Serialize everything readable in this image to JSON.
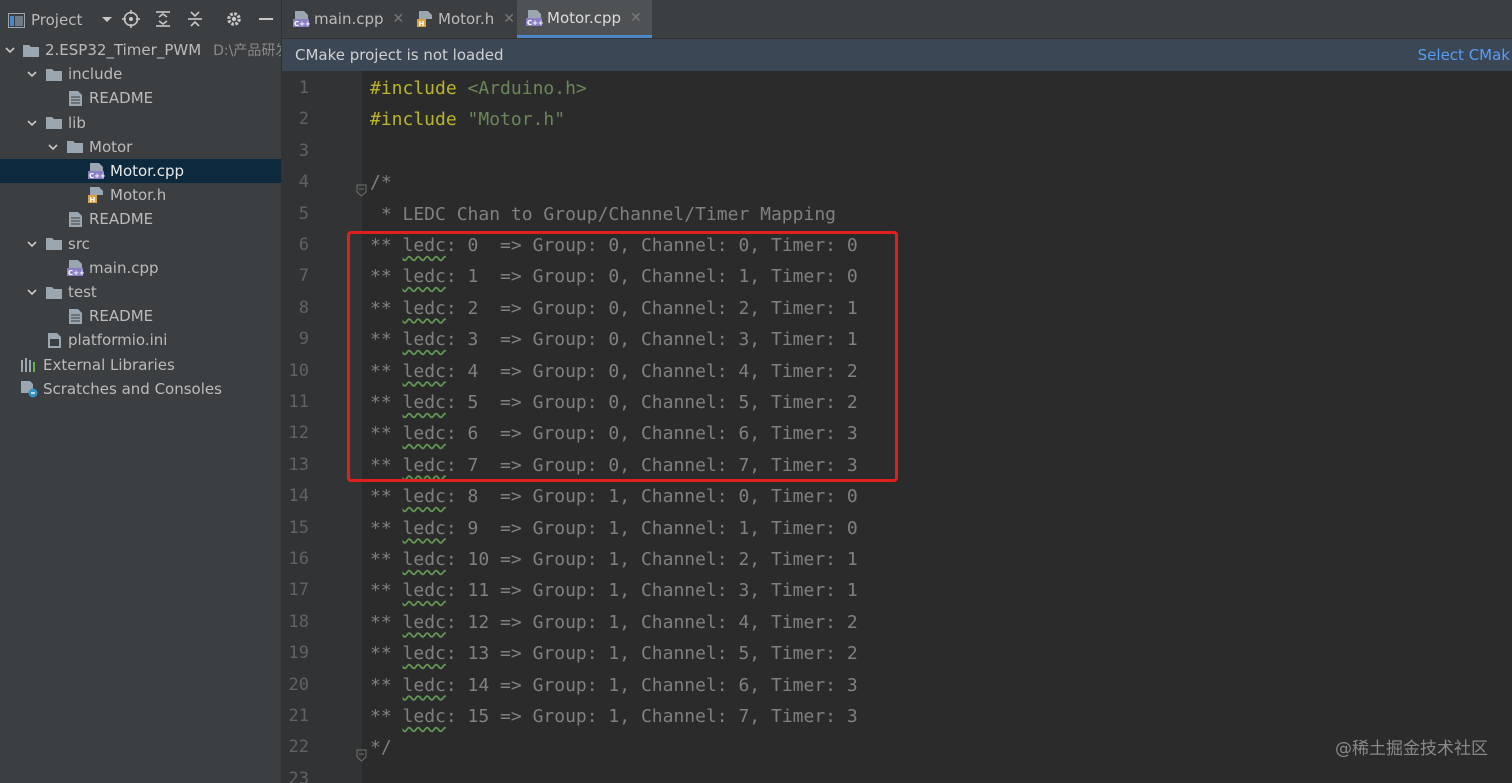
{
  "sidebar": {
    "title": "Project",
    "tree": [
      {
        "label": "2.ESP32_Timer_PWM",
        "path": "D:\\产品研发\\",
        "kind": "folder",
        "expanded": true
      },
      {
        "label": "include",
        "kind": "folder",
        "expanded": true
      },
      {
        "label": "README",
        "kind": "file"
      },
      {
        "label": "lib",
        "kind": "folder",
        "expanded": true
      },
      {
        "label": "Motor",
        "kind": "folder",
        "expanded": true
      },
      {
        "label": "Motor.cpp",
        "kind": "cpp",
        "selected": true
      },
      {
        "label": "Motor.h",
        "kind": "header"
      },
      {
        "label": "README",
        "kind": "file"
      },
      {
        "label": "src",
        "kind": "folder",
        "expanded": true
      },
      {
        "label": "main.cpp",
        "kind": "cpp"
      },
      {
        "label": "test",
        "kind": "folder",
        "expanded": true
      },
      {
        "label": "README",
        "kind": "file"
      },
      {
        "label": "platformio.ini",
        "kind": "ini"
      },
      {
        "label": "External Libraries",
        "kind": "libraries"
      },
      {
        "label": "Scratches and Consoles",
        "kind": "scratches"
      }
    ]
  },
  "tabs": [
    {
      "label": "main.cpp",
      "kind": "cpp",
      "active": false
    },
    {
      "label": "Motor.h",
      "kind": "header",
      "active": false
    },
    {
      "label": "Motor.cpp",
      "kind": "cpp",
      "active": true
    }
  ],
  "banner": {
    "text": "CMake project is not loaded",
    "link": "Select CMak"
  },
  "code_lines": [
    {
      "n": "1",
      "parts": [
        {
          "t": "#include",
          "c": "kw"
        },
        {
          "t": " "
        },
        {
          "t": "<Arduino.h>",
          "c": "str"
        }
      ]
    },
    {
      "n": "2",
      "parts": [
        {
          "t": "#include",
          "c": "kw"
        },
        {
          "t": " "
        },
        {
          "t": "\"Motor.h\"",
          "c": "str"
        }
      ]
    },
    {
      "n": "3",
      "parts": []
    },
    {
      "n": "4",
      "parts": [
        {
          "t": "/*"
        }
      ],
      "fold": true
    },
    {
      "n": "5",
      "parts": [
        {
          "t": " * LEDC Chan to Group/Channel/Timer Mapping"
        }
      ]
    },
    {
      "n": "6",
      "parts": [
        {
          "t": "** "
        },
        {
          "t": "ledc",
          "c": "wavy"
        },
        {
          "t": ": 0  => Group: 0, Channel: 0, Timer: 0"
        }
      ]
    },
    {
      "n": "7",
      "parts": [
        {
          "t": "** "
        },
        {
          "t": "ledc",
          "c": "wavy"
        },
        {
          "t": ": 1  => Group: 0, Channel: 1, Timer: 0"
        }
      ]
    },
    {
      "n": "8",
      "parts": [
        {
          "t": "** "
        },
        {
          "t": "ledc",
          "c": "wavy"
        },
        {
          "t": ": 2  => Group: 0, Channel: 2, Timer: 1"
        }
      ]
    },
    {
      "n": "9",
      "parts": [
        {
          "t": "** "
        },
        {
          "t": "ledc",
          "c": "wavy"
        },
        {
          "t": ": 3  => Group: 0, Channel: 3, Timer: 1"
        }
      ]
    },
    {
      "n": "10",
      "parts": [
        {
          "t": "** "
        },
        {
          "t": "ledc",
          "c": "wavy"
        },
        {
          "t": ": 4  => Group: 0, Channel: 4, Timer: 2"
        }
      ]
    },
    {
      "n": "11",
      "parts": [
        {
          "t": "** "
        },
        {
          "t": "ledc",
          "c": "wavy"
        },
        {
          "t": ": 5  => Group: 0, Channel: 5, Timer: 2"
        }
      ]
    },
    {
      "n": "12",
      "parts": [
        {
          "t": "** "
        },
        {
          "t": "ledc",
          "c": "wavy"
        },
        {
          "t": ": 6  => Group: 0, Channel: 6, Timer: 3"
        }
      ]
    },
    {
      "n": "13",
      "parts": [
        {
          "t": "** "
        },
        {
          "t": "ledc",
          "c": "wavy"
        },
        {
          "t": ": 7  => Group: 0, Channel: 7, Timer: 3"
        }
      ]
    },
    {
      "n": "14",
      "parts": [
        {
          "t": "** "
        },
        {
          "t": "ledc",
          "c": "wavy"
        },
        {
          "t": ": 8  => Group: 1, Channel: 0, Timer: 0"
        }
      ]
    },
    {
      "n": "15",
      "parts": [
        {
          "t": "** "
        },
        {
          "t": "ledc",
          "c": "wavy"
        },
        {
          "t": ": 9  => Group: 1, Channel: 1, Timer: 0"
        }
      ]
    },
    {
      "n": "16",
      "parts": [
        {
          "t": "** "
        },
        {
          "t": "ledc",
          "c": "wavy"
        },
        {
          "t": ": 10 => Group: 1, Channel: 2, Timer: 1"
        }
      ]
    },
    {
      "n": "17",
      "parts": [
        {
          "t": "** "
        },
        {
          "t": "ledc",
          "c": "wavy"
        },
        {
          "t": ": 11 => Group: 1, Channel: 3, Timer: 1"
        }
      ]
    },
    {
      "n": "18",
      "parts": [
        {
          "t": "** "
        },
        {
          "t": "ledc",
          "c": "wavy"
        },
        {
          "t": ": 12 => Group: 1, Channel: 4, Timer: 2"
        }
      ]
    },
    {
      "n": "19",
      "parts": [
        {
          "t": "** "
        },
        {
          "t": "ledc",
          "c": "wavy"
        },
        {
          "t": ": 13 => Group: 1, Channel: 5, Timer: 2"
        }
      ]
    },
    {
      "n": "20",
      "parts": [
        {
          "t": "** "
        },
        {
          "t": "ledc",
          "c": "wavy"
        },
        {
          "t": ": 14 => Group: 1, Channel: 6, Timer: 3"
        }
      ]
    },
    {
      "n": "21",
      "parts": [
        {
          "t": "** "
        },
        {
          "t": "ledc",
          "c": "wavy"
        },
        {
          "t": ": 15 => Group: 1, Channel: 7, Timer: 3"
        }
      ]
    },
    {
      "n": "22",
      "parts": [
        {
          "t": "*/"
        }
      ],
      "fold": true
    },
    {
      "n": "23",
      "parts": []
    }
  ],
  "watermark": "@稀土掘金技术社区",
  "colors": {
    "highlight_box": "#e0201f",
    "selection": "#0d293e",
    "accent": "#4a88c7",
    "link": "#589df6"
  },
  "icons": [
    "project-panel-icon",
    "dropdown-icon",
    "locate-icon",
    "expand-all-icon",
    "collapse-all-icon",
    "settings-icon",
    "hide-icon"
  ]
}
